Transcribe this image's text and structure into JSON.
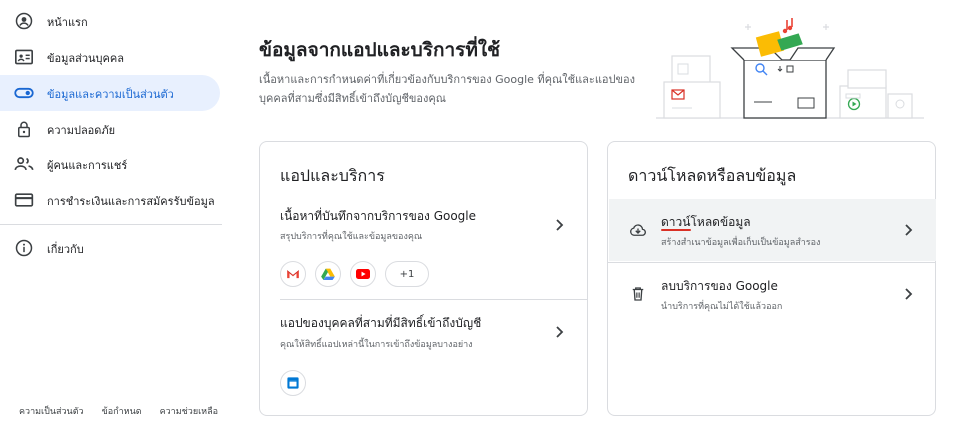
{
  "sidebar": {
    "items": [
      {
        "label": "หน้าแรก",
        "icon": "account-circle-icon"
      },
      {
        "label": "ข้อมูลส่วนบุคคล",
        "icon": "id-card-icon"
      },
      {
        "label": "ข้อมูลและความเป็นส่วนตัว",
        "icon": "toggle-icon"
      },
      {
        "label": "ความปลอดภัย",
        "icon": "lock-icon"
      },
      {
        "label": "ผู้คนและการแชร์",
        "icon": "people-icon"
      },
      {
        "label": "การชำระเงินและการสมัครรับข้อมูล",
        "icon": "credit-card-icon"
      },
      {
        "label": "เกี่ยวกับ",
        "icon": "info-icon"
      }
    ],
    "active_index": 2,
    "footer": [
      "ความเป็นส่วนตัว",
      "ข้อกำหนด",
      "ความช่วยเหลือ"
    ]
  },
  "header": {
    "title": "ข้อมูลจากแอปและบริการที่ใช้",
    "description": "เนื้อหาและการกำหนดค่าที่เกี่ยวข้องกับบริการของ Google ที่คุณใช้และแอปของบุคคลที่สามซึ่งมีสิทธิ์เข้าถึงบัญชีของคุณ"
  },
  "apps_card": {
    "title": "แอปและบริการ",
    "rows": [
      {
        "title": "เนื้อหาที่บันทึกจากบริการของ Google",
        "subtitle": "สรุปบริการที่คุณใช้และข้อมูลของคุณ"
      },
      {
        "title": "แอปของบุคคลที่สามที่มีสิทธิ์เข้าถึงบัญชี",
        "subtitle": "คุณให้สิทธิ์แอปเหล่านี้ในการเข้าถึงข้อมูลบางอย่าง"
      }
    ],
    "service_icons": [
      "gmail-icon",
      "google-drive-icon",
      "youtube-icon"
    ],
    "more_label": "+1",
    "third_party_icon": "windows-app-icon"
  },
  "download_card": {
    "title": "ดาวน์โหลดหรือลบข้อมูล",
    "rows": [
      {
        "title": "ดาวน์โหลดข้อมูล",
        "subtitle": "สร้างสำเนาข้อมูลเพื่อเก็บเป็นข้อมูลสำรอง",
        "icon": "cloud-download-icon"
      },
      {
        "title": "ลบบริการของ Google",
        "subtitle": "นำบริการที่คุณไม่ได้ใช้แล้วออก",
        "icon": "trash-icon"
      }
    ]
  },
  "colors": {
    "accent": "#1967d2",
    "active_bg": "#e8f0fe",
    "border": "#dadce0",
    "hover_bg": "#f1f3f4"
  }
}
